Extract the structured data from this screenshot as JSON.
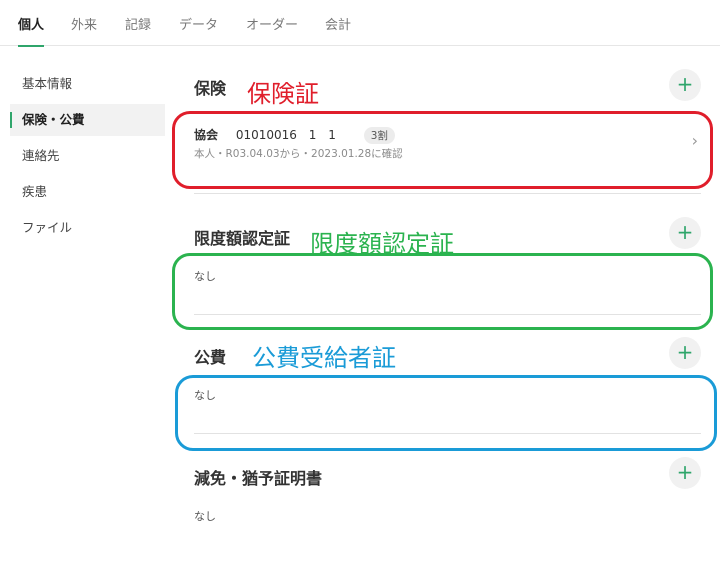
{
  "tabs": [
    "個人",
    "外来",
    "記録",
    "データ",
    "オーダー",
    "会計"
  ],
  "sidebar": {
    "items": [
      "基本情報",
      "保険・公費",
      "連絡先",
      "疾患",
      "ファイル"
    ]
  },
  "sections": {
    "insurance": {
      "title": "保険",
      "annotation": "保険証",
      "row": {
        "org": "協会",
        "number": "01010016",
        "branch1": "1",
        "branch2": "1",
        "badge": "3割",
        "sub": "本人・R03.04.03から・2023.01.28に確認"
      }
    },
    "limit": {
      "title": "限度額認定証",
      "annotation": "限度額認定証",
      "empty": "なし"
    },
    "public": {
      "title": "公費",
      "annotation": "公費受給者証",
      "empty": "なし"
    },
    "reduction": {
      "title": "減免・猶予証明書",
      "empty": "なし"
    }
  },
  "icons": {
    "add": "+",
    "chevron": "›"
  },
  "colors": {
    "accent": "#2fa56b",
    "annotation_red": "#e01e2b",
    "annotation_green": "#2bb34f",
    "annotation_blue": "#1a9bd7"
  }
}
